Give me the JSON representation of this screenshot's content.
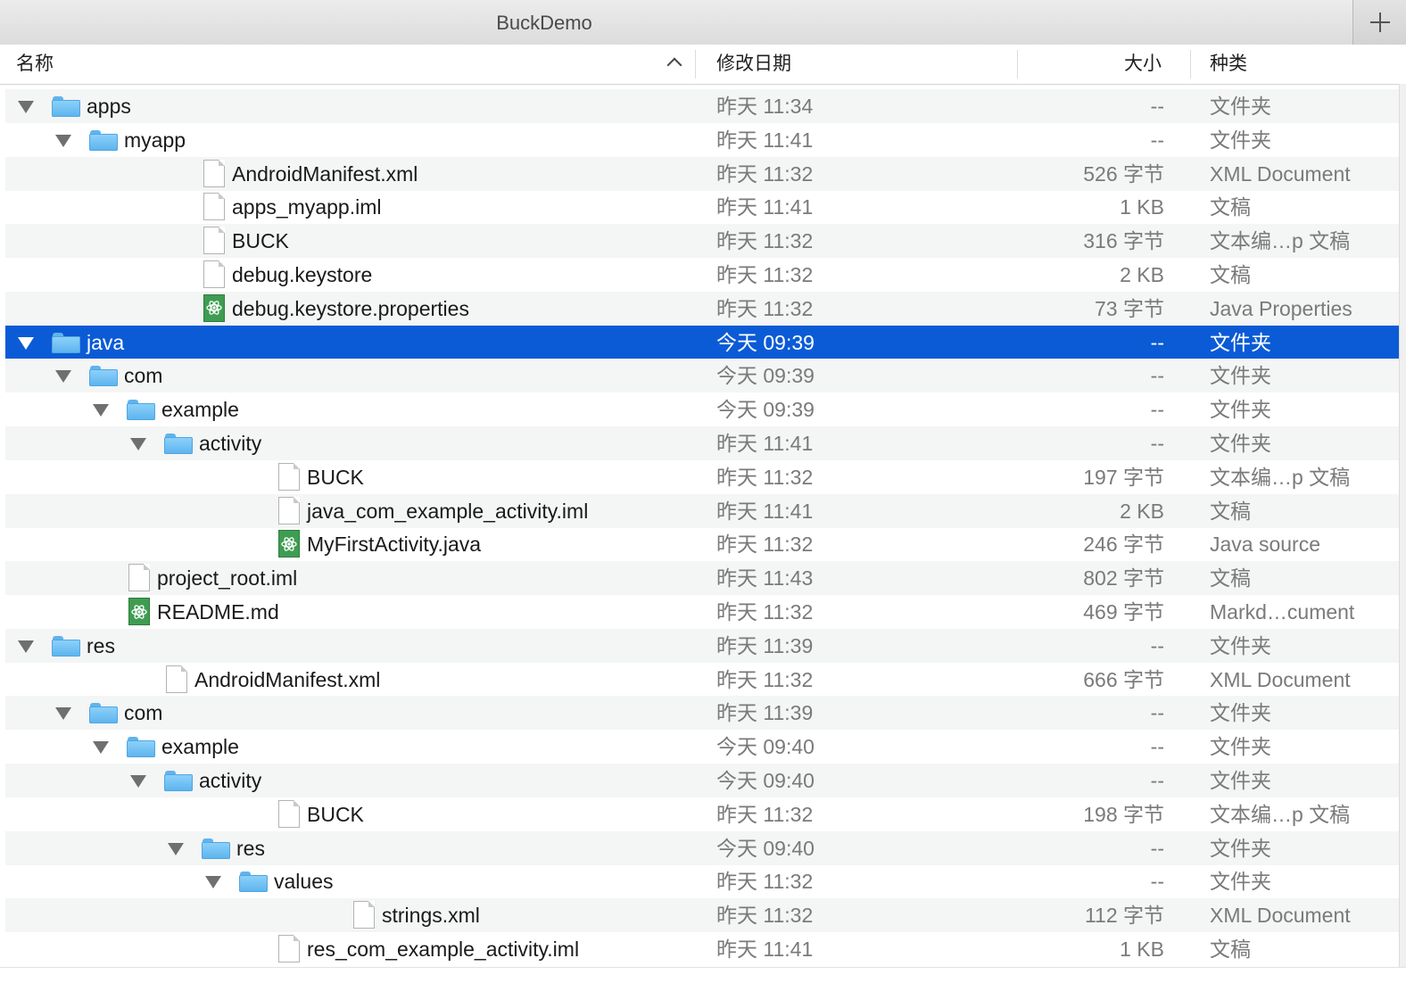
{
  "window": {
    "title": "BuckDemo"
  },
  "columns": {
    "name": "名称",
    "date": "修改日期",
    "size": "大小",
    "kind": "种类"
  },
  "accent": "#0b5bd6",
  "rows": [
    {
      "name": "apps",
      "date": "昨天 11:34",
      "size": "--",
      "kind": "文件夹",
      "depth": 0,
      "icon": "folder-icon",
      "expanded": true
    },
    {
      "name": "myapp",
      "date": "昨天 11:41",
      "size": "--",
      "kind": "文件夹",
      "depth": 1,
      "icon": "folder-icon",
      "expanded": true
    },
    {
      "name": "AndroidManifest.xml",
      "date": "昨天 11:32",
      "size": "526 字节",
      "kind": "XML Document",
      "depth": 2,
      "icon": "document-icon"
    },
    {
      "name": "apps_myapp.iml",
      "date": "昨天 11:41",
      "size": "1 KB",
      "kind": "文稿",
      "depth": 2,
      "icon": "document-icon"
    },
    {
      "name": "BUCK",
      "date": "昨天 11:32",
      "size": "316 字节",
      "kind": "文本编…p 文稿",
      "depth": 2,
      "icon": "document-icon"
    },
    {
      "name": "debug.keystore",
      "date": "昨天 11:32",
      "size": "2 KB",
      "kind": "文稿",
      "depth": 2,
      "icon": "document-icon"
    },
    {
      "name": "debug.keystore.properties",
      "date": "昨天 11:32",
      "size": "73 字节",
      "kind": "Java Properties",
      "depth": 2,
      "icon": "atom-file-icon"
    },
    {
      "name": "java",
      "date": "今天 09:39",
      "size": "--",
      "kind": "文件夹",
      "depth": 0,
      "icon": "folder-icon",
      "expanded": true,
      "selected": true
    },
    {
      "name": "com",
      "date": "今天 09:39",
      "size": "--",
      "kind": "文件夹",
      "depth": 1,
      "icon": "folder-icon",
      "expanded": true
    },
    {
      "name": "example",
      "date": "今天 09:39",
      "size": "--",
      "kind": "文件夹",
      "depth": 2,
      "icon": "folder-icon",
      "expanded": true
    },
    {
      "name": "activity",
      "date": "昨天 11:41",
      "size": "--",
      "kind": "文件夹",
      "depth": 3,
      "icon": "folder-icon",
      "expanded": true
    },
    {
      "name": "BUCK",
      "date": "昨天 11:32",
      "size": "197 字节",
      "kind": "文本编…p 文稿",
      "depth": 4,
      "icon": "document-icon"
    },
    {
      "name": "java_com_example_activity.iml",
      "date": "昨天 11:41",
      "size": "2 KB",
      "kind": "文稿",
      "depth": 4,
      "icon": "document-icon"
    },
    {
      "name": "MyFirstActivity.java",
      "date": "昨天 11:32",
      "size": "246 字节",
      "kind": "Java source",
      "depth": 4,
      "icon": "atom-file-icon"
    },
    {
      "name": "project_root.iml",
      "date": "昨天 11:43",
      "size": "802 字节",
      "kind": "文稿",
      "depth": 0,
      "icon": "document-icon"
    },
    {
      "name": "README.md",
      "date": "昨天 11:32",
      "size": "469 字节",
      "kind": "Markd…cument",
      "depth": 0,
      "icon": "atom-file-icon"
    },
    {
      "name": "res",
      "date": "昨天 11:39",
      "size": "--",
      "kind": "文件夹",
      "depth": 0,
      "icon": "folder-icon",
      "expanded": true
    },
    {
      "name": "AndroidManifest.xml",
      "date": "昨天 11:32",
      "size": "666 字节",
      "kind": "XML Document",
      "depth": 1,
      "icon": "document-icon"
    },
    {
      "name": "com",
      "date": "昨天 11:39",
      "size": "--",
      "kind": "文件夹",
      "depth": 1,
      "icon": "folder-icon",
      "expanded": true
    },
    {
      "name": "example",
      "date": "今天 09:40",
      "size": "--",
      "kind": "文件夹",
      "depth": 2,
      "icon": "folder-icon",
      "expanded": true
    },
    {
      "name": "activity",
      "date": "今天 09:40",
      "size": "--",
      "kind": "文件夹",
      "depth": 3,
      "icon": "folder-icon",
      "expanded": true
    },
    {
      "name": "BUCK",
      "date": "昨天 11:32",
      "size": "198 字节",
      "kind": "文本编…p 文稿",
      "depth": 4,
      "icon": "document-icon"
    },
    {
      "name": "res",
      "date": "今天 09:40",
      "size": "--",
      "kind": "文件夹",
      "depth": 4,
      "icon": "folder-icon",
      "expanded": true
    },
    {
      "name": "values",
      "date": "昨天 11:32",
      "size": "--",
      "kind": "文件夹",
      "depth": 5,
      "icon": "folder-icon",
      "expanded": true
    },
    {
      "name": "strings.xml",
      "date": "昨天 11:32",
      "size": "112 字节",
      "kind": "XML Document",
      "depth": 6,
      "icon": "document-icon"
    },
    {
      "name": "res_com_example_activity.iml",
      "date": "昨天 11:41",
      "size": "1 KB",
      "kind": "文稿",
      "depth": 4,
      "icon": "document-icon"
    }
  ]
}
